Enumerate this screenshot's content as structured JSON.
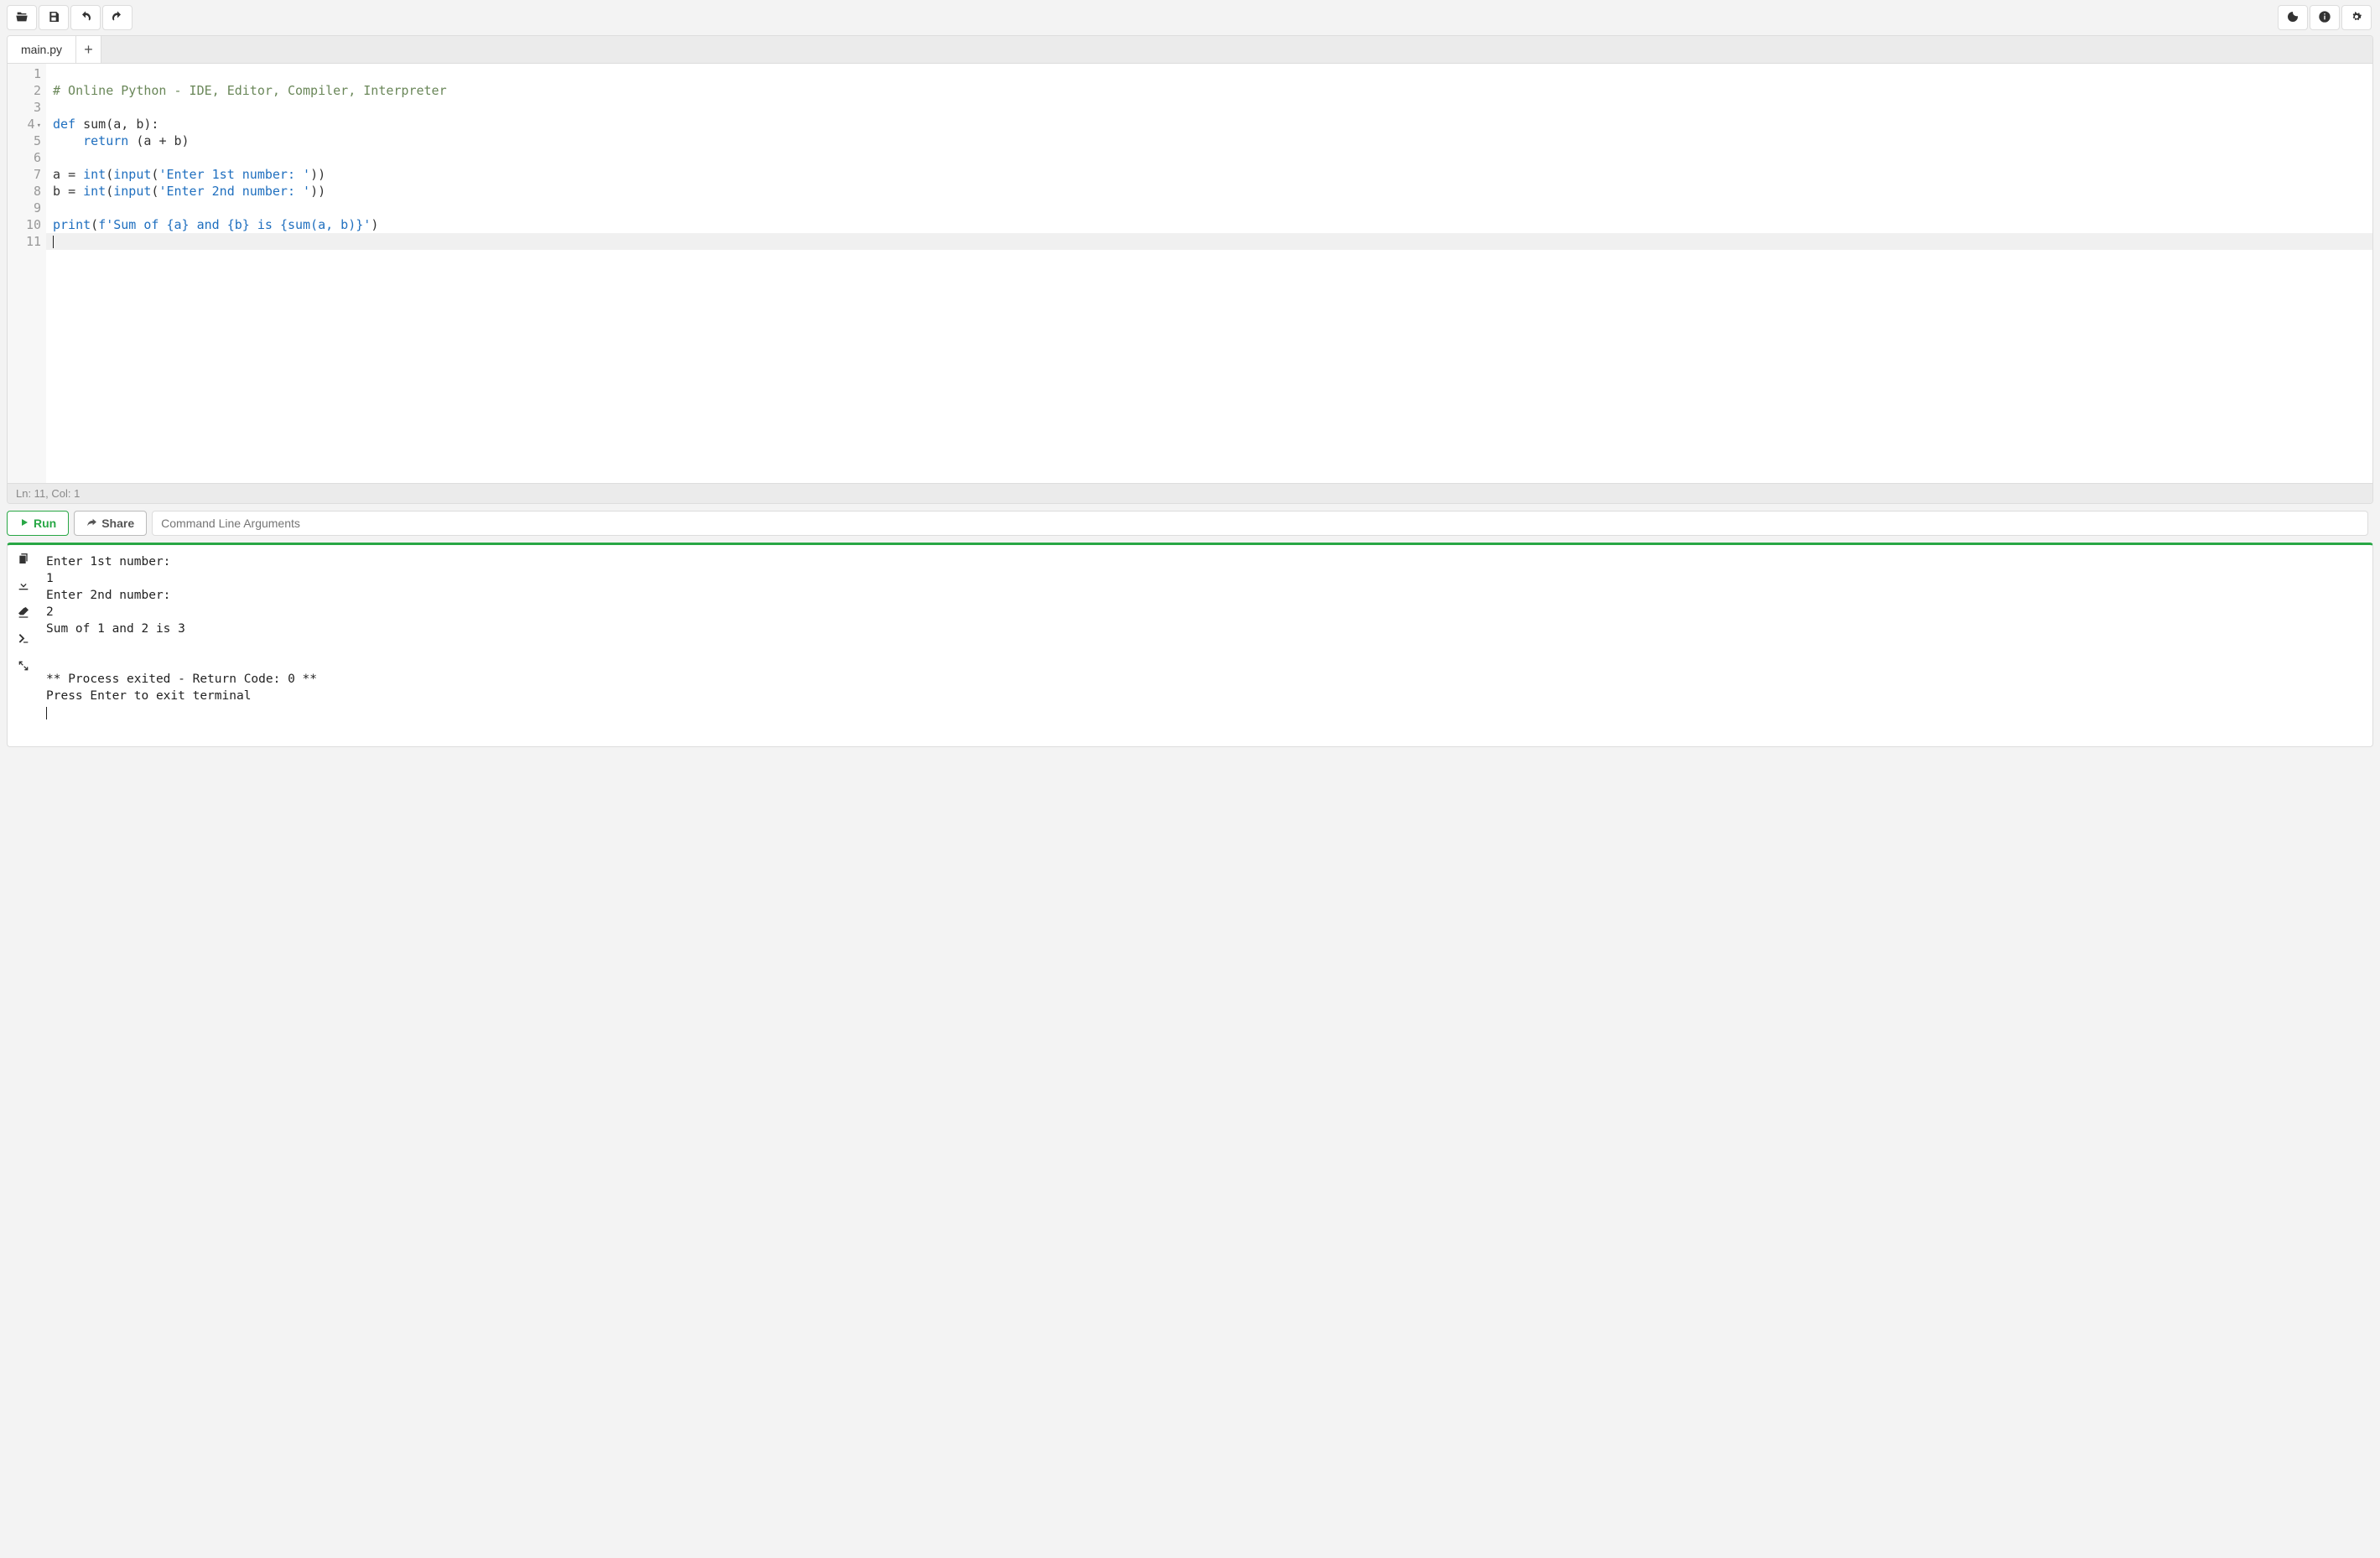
{
  "toolbar": {
    "open_icon": "open-folder-icon",
    "save_icon": "save-icon",
    "undo_icon": "undo-icon",
    "redo_icon": "redo-icon",
    "dark_icon": "moon-icon",
    "info_icon": "info-icon",
    "settings_icon": "gears-icon"
  },
  "tabs": [
    {
      "label": "main.py"
    }
  ],
  "editor": {
    "lines": [
      {
        "num": "1",
        "tokens": []
      },
      {
        "num": "2",
        "tokens": [
          {
            "t": "# Online Python - IDE, Editor, Compiler, Interpreter",
            "c": "comment"
          }
        ]
      },
      {
        "num": "3",
        "tokens": []
      },
      {
        "num": "4",
        "fold": true,
        "tokens": [
          {
            "t": "def",
            "c": "kw"
          },
          {
            "t": " "
          },
          {
            "t": "sum",
            "c": "fn"
          },
          {
            "t": "(a, b):"
          }
        ]
      },
      {
        "num": "5",
        "tokens": [
          {
            "t": "    "
          },
          {
            "t": "return",
            "c": "kw"
          },
          {
            "t": " (a "
          },
          {
            "t": "+",
            "c": "op"
          },
          {
            "t": " b)"
          }
        ]
      },
      {
        "num": "6",
        "tokens": []
      },
      {
        "num": "7",
        "tokens": [
          {
            "t": "a "
          },
          {
            "t": "=",
            "c": "op"
          },
          {
            "t": " "
          },
          {
            "t": "int",
            "c": "builtin"
          },
          {
            "t": "("
          },
          {
            "t": "input",
            "c": "builtin"
          },
          {
            "t": "("
          },
          {
            "t": "'Enter 1st number: '",
            "c": "str"
          },
          {
            "t": "))"
          }
        ]
      },
      {
        "num": "8",
        "tokens": [
          {
            "t": "b "
          },
          {
            "t": "=",
            "c": "op"
          },
          {
            "t": " "
          },
          {
            "t": "int",
            "c": "builtin"
          },
          {
            "t": "("
          },
          {
            "t": "input",
            "c": "builtin"
          },
          {
            "t": "("
          },
          {
            "t": "'Enter 2nd number: '",
            "c": "str"
          },
          {
            "t": "))"
          }
        ]
      },
      {
        "num": "9",
        "tokens": []
      },
      {
        "num": "10",
        "tokens": [
          {
            "t": "print",
            "c": "builtin"
          },
          {
            "t": "("
          },
          {
            "t": "f'Sum of ",
            "c": "str"
          },
          {
            "t": "{a}",
            "c": "str"
          },
          {
            "t": " and ",
            "c": "str"
          },
          {
            "t": "{b}",
            "c": "str"
          },
          {
            "t": " is ",
            "c": "str"
          },
          {
            "t": "{sum(a, b)}",
            "c": "str"
          },
          {
            "t": "'",
            "c": "str"
          },
          {
            "t": ")"
          }
        ]
      },
      {
        "num": "11",
        "tokens": [],
        "active": true
      }
    ],
    "status": "Ln: 11,  Col: 1"
  },
  "runbar": {
    "run_label": "Run",
    "share_label": "Share",
    "cli_placeholder": "Command Line Arguments"
  },
  "terminal": {
    "lines": [
      "Enter 1st number: ",
      "1",
      "Enter 2nd number: ",
      "2",
      "Sum of 1 and 2 is 3",
      "",
      "",
      "** Process exited - Return Code: 0 **",
      "Press Enter to exit terminal"
    ]
  }
}
